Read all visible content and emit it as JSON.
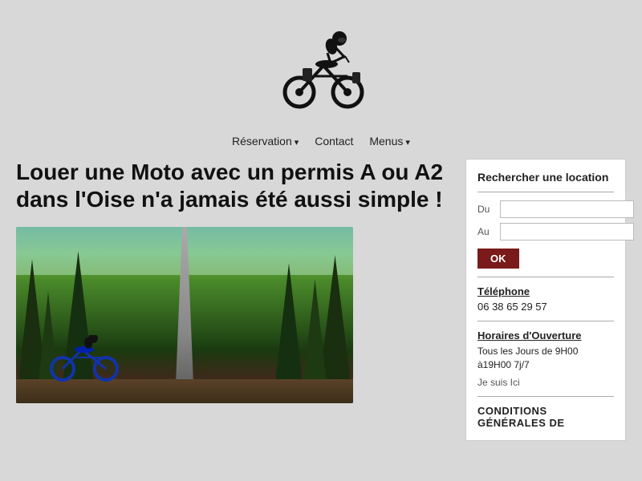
{
  "header": {
    "logo_alt": "Moto logo"
  },
  "nav": {
    "items": [
      {
        "label": "Réservation",
        "has_arrow": true
      },
      {
        "label": "Contact",
        "has_arrow": false
      },
      {
        "label": "Menus",
        "has_arrow": true
      }
    ]
  },
  "main": {
    "page_title": "Louer une Moto avec un permis A ou A2 dans l'Oise n'a jamais été aussi simple !",
    "hero_image_alt": "Moto dans une forêt"
  },
  "sidebar": {
    "search_title": "Rechercher une location",
    "du_label": "Du",
    "au_label": "Au",
    "du_value": "",
    "au_value": "",
    "ok_label": "OK",
    "telephone_label": "Téléphone",
    "telephone_number": "06 38 65 29 57",
    "horaires_label": "Horaires d'Ouverture",
    "horaires_text": "Tous les Jours de 9H00 à19H00 7j/7",
    "je_suis_text": "Je suis Ici",
    "cgv_label": "CONDITIONS GÉNÉRALES DE"
  }
}
